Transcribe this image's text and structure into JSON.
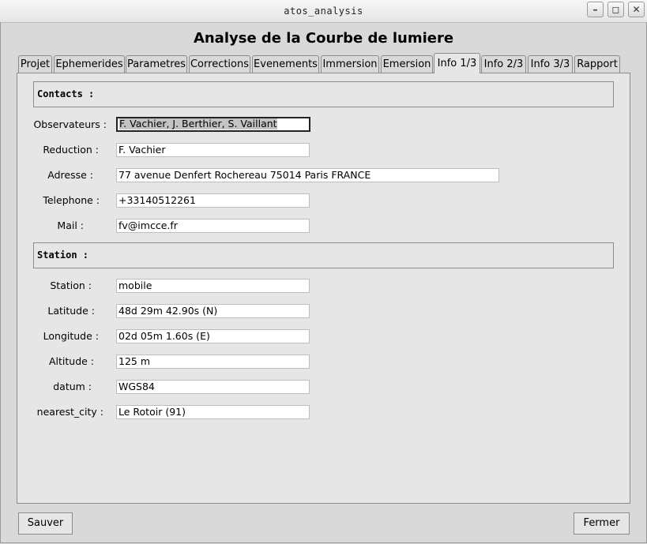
{
  "window": {
    "title": "atos_analysis"
  },
  "app": {
    "title": "Analyse de la Courbe de lumiere"
  },
  "tabs": [
    {
      "label": "Projet"
    },
    {
      "label": "Ephemerides"
    },
    {
      "label": "Parametres"
    },
    {
      "label": "Corrections"
    },
    {
      "label": "Evenements"
    },
    {
      "label": "Immersion"
    },
    {
      "label": "Emersion"
    },
    {
      "label": "Info 1/3",
      "active": true
    },
    {
      "label": "Info 2/3"
    },
    {
      "label": "Info 3/3"
    },
    {
      "label": "Rapport"
    }
  ],
  "contacts": {
    "header": "Contacts :",
    "observateurs_label": "Observateurs :",
    "observateurs_value": "F. Vachier, J. Berthier, S. Vaillant",
    "reduction_label": "Reduction :",
    "reduction_value": "F. Vachier",
    "adresse_label": "Adresse :",
    "adresse_value": "77 avenue Denfert Rochereau 75014 Paris FRANCE",
    "telephone_label": "Telephone :",
    "telephone_value": "+33140512261",
    "mail_label": "Mail :",
    "mail_value": "fv@imcce.fr"
  },
  "station": {
    "header": "Station :",
    "station_label": "Station :",
    "station_value": "mobile",
    "latitude_label": "Latitude :",
    "latitude_value": "48d 29m 42.90s (N)",
    "longitude_label": "Longitude :",
    "longitude_value": "02d 05m 1.60s (E)",
    "altitude_label": "Altitude :",
    "altitude_value": "125 m",
    "datum_label": "datum :",
    "datum_value": "WGS84",
    "nearest_city_label": "nearest_city :",
    "nearest_city_value": "Le Rotoir (91)"
  },
  "buttons": {
    "save": "Sauver",
    "close": "Fermer"
  }
}
